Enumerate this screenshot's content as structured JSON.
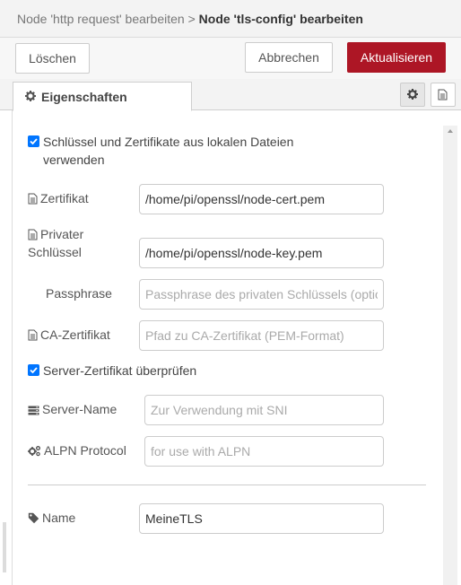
{
  "header": {
    "crumb_parent": "Node 'http request' bearbeiten",
    "crumb_sep": ">",
    "crumb_current": "Node 'tls-config' bearbeiten"
  },
  "toolbar": {
    "delete_label": "Löschen",
    "cancel_label": "Abbrechen",
    "update_label": "Aktualisieren",
    "update_color": "#ad1625"
  },
  "tabs": {
    "properties_label": "Eigenschaften",
    "properties_icon": "gear-icon",
    "side_buttons": [
      "gear-icon",
      "file-icon"
    ]
  },
  "form": {
    "use_local_files": {
      "checked": true,
      "line1": "Schlüssel und Zertifikate aus lokalen Dateien",
      "line2": "verwenden"
    },
    "certificate": {
      "label": "Zertifikat",
      "icon": "file-icon",
      "value": "/home/pi/openssl/node-cert.pem"
    },
    "private_key": {
      "label_line1": "Privater",
      "label_line2": "Schlüssel",
      "icon": "file-icon",
      "value": "/home/pi/openssl/node-key.pem"
    },
    "passphrase": {
      "label": "Passphrase",
      "placeholder": "Passphrase des privaten Schlüssels (optional)"
    },
    "ca_certificate": {
      "label": "CA-Zertifikat",
      "icon": "file-icon",
      "placeholder": "Pfad zu CA-Zertifikat (PEM-Format)"
    },
    "verify_server": {
      "checked": true,
      "label": "Server-Zertifikat überprüfen"
    },
    "server_name": {
      "label": "Server-Name",
      "icon": "server-icon",
      "placeholder": "Zur Verwendung mit SNI"
    },
    "alpn": {
      "label": "ALPN Protocol",
      "icon": "gears-icon",
      "placeholder": "for use with ALPN"
    },
    "name": {
      "label": "Name",
      "icon": "tag-icon",
      "value": "MeineTLS"
    }
  },
  "colors": {
    "checkbox": "#0075ff"
  }
}
